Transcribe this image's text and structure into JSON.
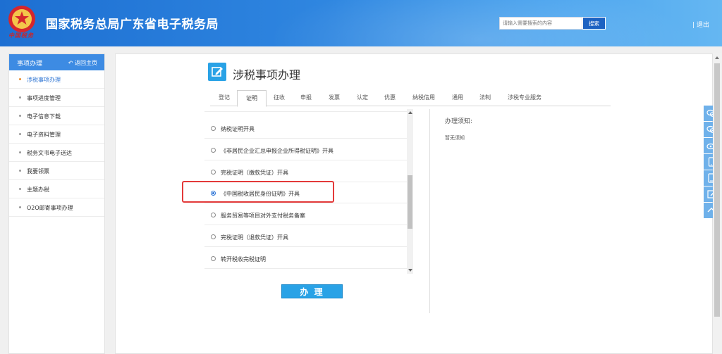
{
  "header": {
    "emblem_text": "中国税务",
    "title": "国家税务总局广东省电子税务局",
    "search_placeholder": "请输入需要搜索的内容",
    "search_button": "搜索",
    "logout": "| 退出"
  },
  "sidebar": {
    "title": "事项办理",
    "back_label": "返回主页",
    "items": [
      {
        "label": "涉税事项办理"
      },
      {
        "label": "事项进度管理"
      },
      {
        "label": "电子信息下载"
      },
      {
        "label": "电子资料管理"
      },
      {
        "label": "税务文书电子送达"
      },
      {
        "label": "我要领票"
      },
      {
        "label": "主题办税"
      },
      {
        "label": "O2O邮寄事项办理"
      }
    ]
  },
  "main": {
    "page_title": "涉税事项办理",
    "tabs": [
      {
        "label": "登记"
      },
      {
        "label": "证明"
      },
      {
        "label": "征收"
      },
      {
        "label": "申报"
      },
      {
        "label": "发票"
      },
      {
        "label": "认定"
      },
      {
        "label": "优惠"
      },
      {
        "label": "纳税信用"
      },
      {
        "label": "通用"
      },
      {
        "label": "法制"
      },
      {
        "label": "涉税专业服务"
      }
    ],
    "active_tab": "证明",
    "options": [
      {
        "label": "纳税证明开具"
      },
      {
        "label": "《非居民企业汇总申报企业所得税证明》开具"
      },
      {
        "label": "完税证明（缴款凭证）开具"
      },
      {
        "label": "《中国税收居民身份证明》开具"
      },
      {
        "label": "服务贸易等项目对外支付税务备案"
      },
      {
        "label": "完税证明（退款凭证）开具"
      },
      {
        "label": "转开税收完税证明"
      }
    ],
    "selected_option": "《中国税收居民身份证明》开具",
    "notice_title": "办理须知:",
    "notice_body": "暂无须知",
    "submit_button": "办 理"
  },
  "colors": {
    "header_blue": "#2f86e0",
    "accent_blue": "#29a2e6",
    "highlight_red": "#e33a3a"
  }
}
